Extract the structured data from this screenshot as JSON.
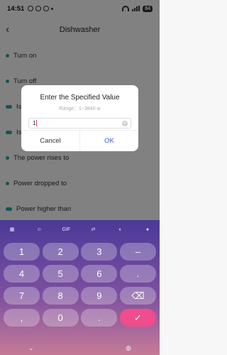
{
  "status_bar": {
    "time": "14:51",
    "battery": "84"
  },
  "header": {
    "title": "Dishwasher",
    "back_icon": "chevron-left-icon"
  },
  "list_items": [
    "Turn on",
    "Turn off",
    "Is c",
    "Is c",
    "The power rises to",
    "Power dropped to",
    "Power higher than"
  ],
  "dialog": {
    "title": "Enter the Specified Value",
    "range": "Range：1~3840 w",
    "input_value": "1",
    "cancel_label": "Cancel",
    "ok_label": "OK"
  },
  "keyboard": {
    "toolbar": [
      "grid-icon",
      "sticker-icon",
      "GIF",
      "translate-icon",
      "palette-icon",
      "mic-icon"
    ],
    "gif_label": "GIF",
    "rows": [
      [
        "1",
        "2",
        "3",
        "–"
      ],
      [
        "4",
        "5",
        "6",
        "."
      ],
      [
        "7",
        "8",
        "9",
        "⌫"
      ],
      [
        ",",
        "0",
        ".",
        "✓"
      ]
    ]
  },
  "colors": {
    "accent": "#3b5bdb",
    "marker": "#2aa3a0",
    "key_action": "#ef4d8c"
  }
}
